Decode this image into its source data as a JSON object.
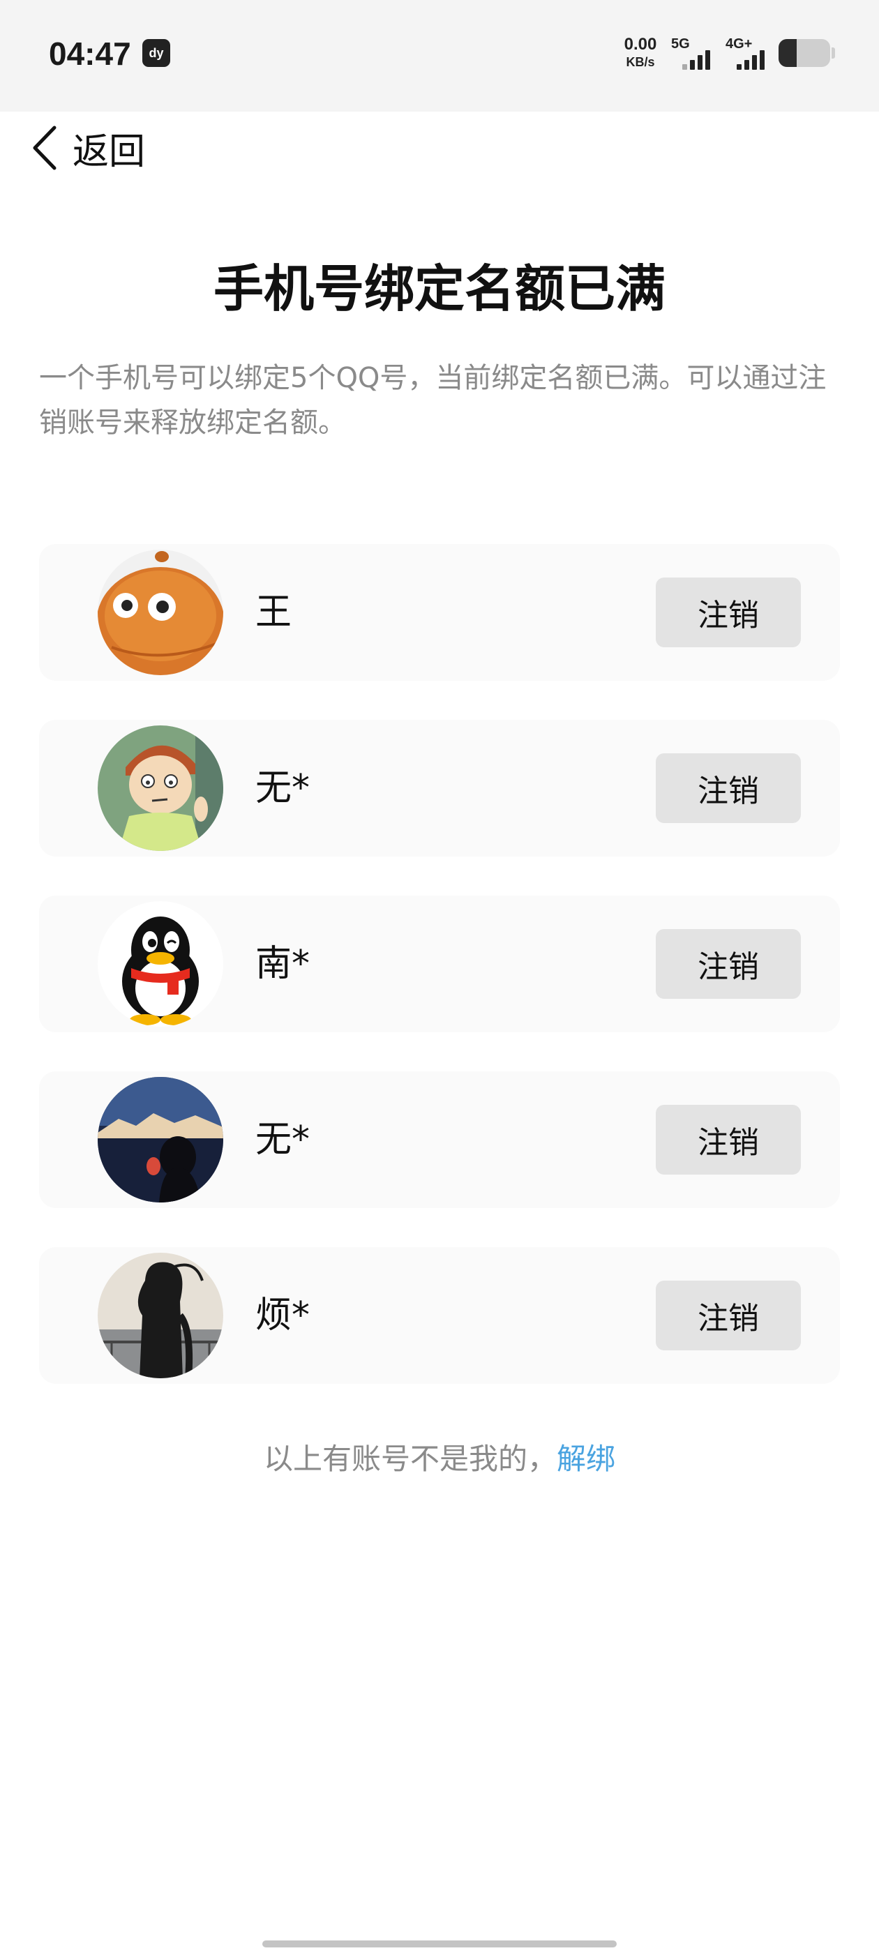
{
  "status_bar": {
    "time": "04:47",
    "app_indicator": "dy",
    "net_speed_value": "0.00",
    "net_speed_unit": "KB/s",
    "signal1_label": "5G",
    "signal2_label": "4G+",
    "battery_level": 0.35
  },
  "nav": {
    "back_label": "返回"
  },
  "title": "手机号绑定名额已满",
  "description": "一个手机号可以绑定5个QQ号，当前绑定名额已满。可以通过注销账号来释放绑定名额。",
  "accounts": [
    {
      "name": "王",
      "button_label": "注销",
      "avatar": "orange-blob-avatar"
    },
    {
      "name": "无*",
      "button_label": "注销",
      "avatar": "cartoon-boy-avatar"
    },
    {
      "name": "南*",
      "button_label": "注销",
      "avatar": "qq-penguin-avatar"
    },
    {
      "name": "无*",
      "button_label": "注销",
      "avatar": "mountain-girl-avatar"
    },
    {
      "name": "烦*",
      "button_label": "注销",
      "avatar": "sunset-girl-avatar"
    }
  ],
  "footer": {
    "text": "以上有账号不是我的，",
    "link_label": "解绑"
  },
  "colors": {
    "link": "#4aa3e0",
    "button_bg": "#e3e3e3",
    "card_bg": "#fafafa",
    "status_bg": "#f4f4f4"
  }
}
